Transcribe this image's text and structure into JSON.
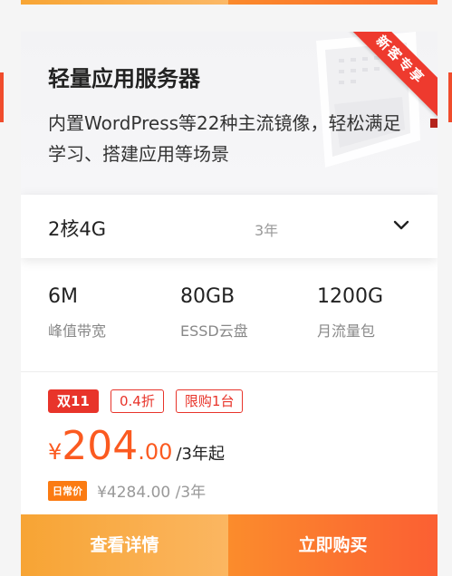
{
  "card": {
    "title": "轻量应用服务器",
    "description": "内置WordPress等22种主流镜像，轻松满足学习、搭建应用等场景",
    "badge": "新客专享"
  },
  "selector": {
    "spec": "2核4G",
    "term": "3年"
  },
  "specs": [
    {
      "value": "6M",
      "label": "峰值带宽"
    },
    {
      "value": "80GB",
      "label": "ESSD云盘"
    },
    {
      "value": "1200G",
      "label": "月流量包"
    }
  ],
  "tags": [
    "双11",
    "0.4折",
    "限购1台"
  ],
  "price": {
    "currency": "¥",
    "integer": "204",
    "decimal": ".00",
    "unit": "/3年起"
  },
  "original": {
    "badge": "日常价",
    "text": "¥4284.00 /3年"
  },
  "buttons": {
    "details": "查看详情",
    "buy": "立即购买"
  },
  "colors": {
    "accent": "#fb5a20",
    "tag_red": "#e8342a",
    "ribbon": "#ee3a2e"
  }
}
